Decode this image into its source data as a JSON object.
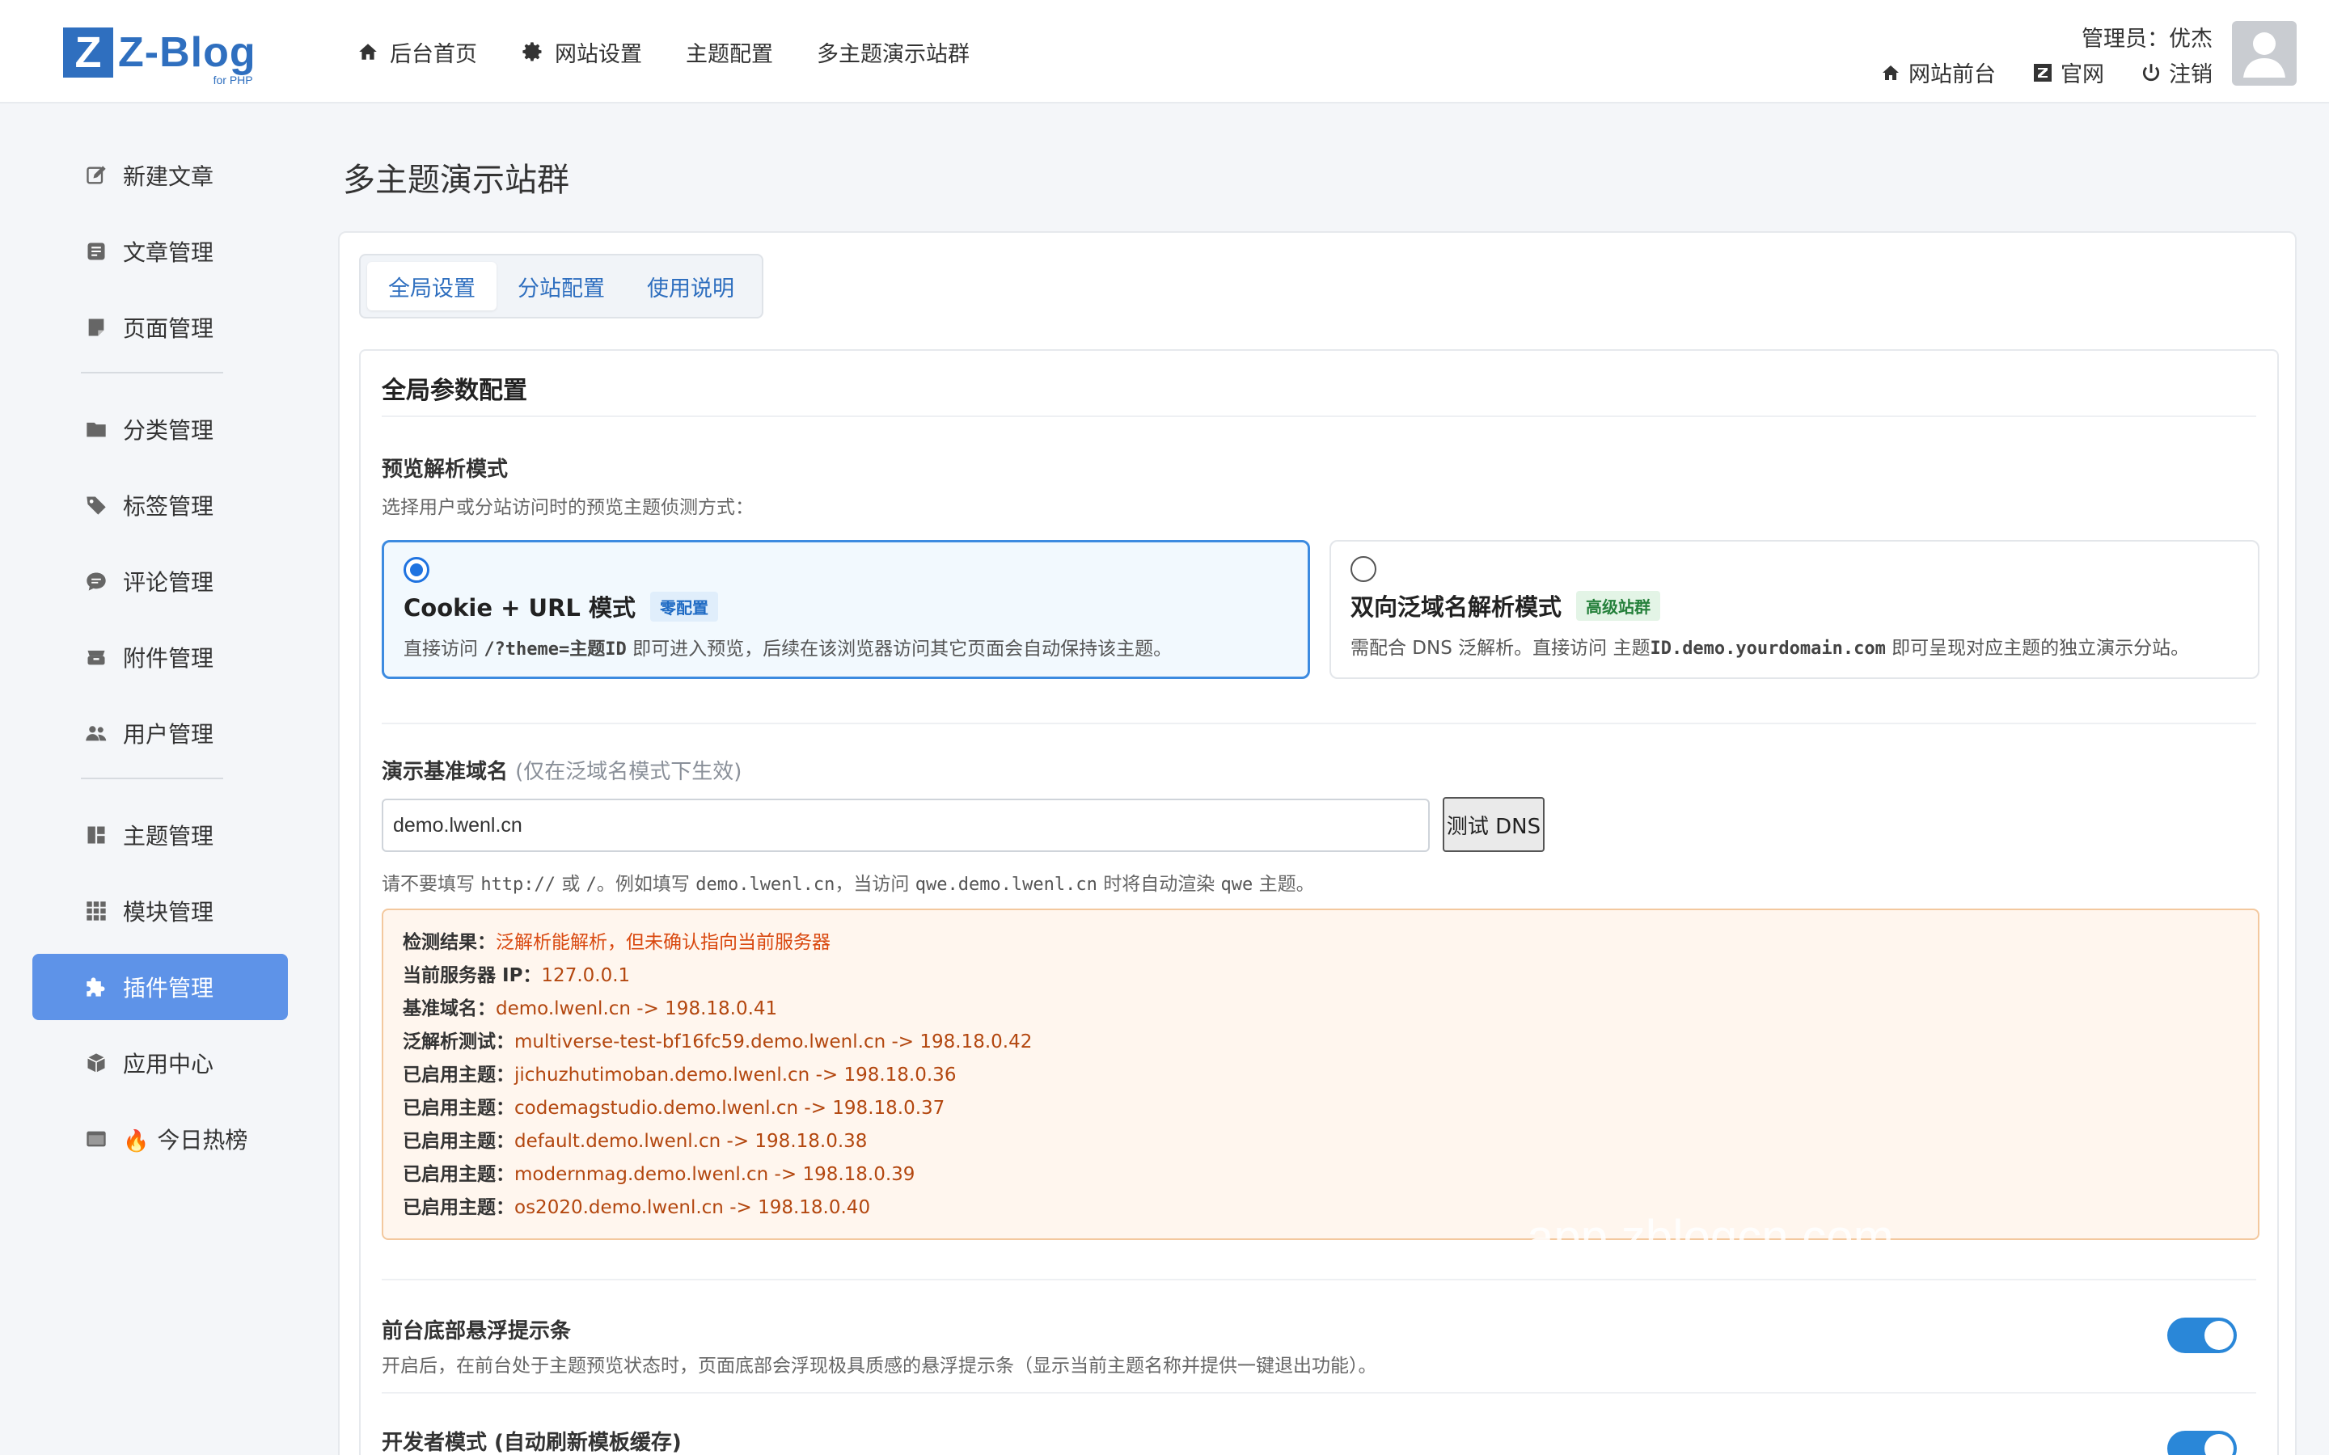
{
  "header": {
    "logo_letter": "Z",
    "logo_name": "Z-Blog",
    "logo_sub": "for PHP",
    "nav": [
      {
        "label": "后台首页",
        "icon": "home-icon"
      },
      {
        "label": "网站设置",
        "icon": "gear-icon"
      },
      {
        "label": "主题配置",
        "icon": ""
      },
      {
        "label": "多主题演示站群",
        "icon": ""
      }
    ],
    "admin_label": "管理员：优杰",
    "quick_links": [
      {
        "label": "网站前台",
        "icon": "home-icon"
      },
      {
        "label": "官网",
        "icon": "zblog-logo-icon"
      },
      {
        "label": "注销",
        "icon": "power-icon"
      }
    ]
  },
  "sidebar": {
    "items": [
      {
        "label": "新建文章",
        "icon": "edit-icon"
      },
      {
        "label": "文章管理",
        "icon": "article-icon"
      },
      {
        "label": "页面管理",
        "icon": "page-icon"
      },
      {
        "label": "分类管理",
        "icon": "folder-icon"
      },
      {
        "label": "标签管理",
        "icon": "tag-icon"
      },
      {
        "label": "评论管理",
        "icon": "comment-icon"
      },
      {
        "label": "附件管理",
        "icon": "attachment-icon"
      },
      {
        "label": "用户管理",
        "icon": "users-icon"
      },
      {
        "label": "主题管理",
        "icon": "theme-icon"
      },
      {
        "label": "模块管理",
        "icon": "grid-icon"
      },
      {
        "label": "插件管理",
        "icon": "puzzle-icon",
        "active": true
      },
      {
        "label": "应用中心",
        "icon": "box-icon"
      },
      {
        "label": "今日热榜",
        "icon": "window-icon",
        "emoji": "🔥"
      }
    ]
  },
  "main": {
    "page_title": "多主题演示站群",
    "tabs": [
      "全局设置",
      "分站配置",
      "使用说明"
    ],
    "card_title": "全局参数配置",
    "preview_mode": {
      "label": "预览解析模式",
      "desc": "选择用户或分站访问时的预览主题侦测方式：",
      "options": [
        {
          "title": "Cookie + URL 模式",
          "badge": "零配置",
          "desc_pre": "直接访问 ",
          "desc_code": "/?theme=主题ID",
          "desc_post": " 即可进入预览，后续在该浏览器访问其它页面会自动保持该主题。",
          "selected": true
        },
        {
          "title": "双向泛域名解析模式",
          "badge": "高级站群",
          "desc_pre": "需配合 DNS 泛解析。直接访问 主题",
          "desc_code": "ID.demo.yourdomain.com",
          "desc_post": " 即可呈现对应主题的独立演示分站。",
          "selected": false
        }
      ]
    },
    "base_domain": {
      "label": "演示基准域名",
      "label_note": "(仅在泛域名模式下生效)",
      "value": "demo.lwenl.cn",
      "button": "测试 DNS",
      "hint_1": "请不要填写 ",
      "hint_code_1": "http://",
      "hint_2": " 或 ",
      "hint_code_2": "/",
      "hint_3": "。例如填写 ",
      "hint_code_3": "demo.lwenl.cn",
      "hint_4": "，当访问 ",
      "hint_code_4": "qwe.demo.lwenl.cn",
      "hint_5": " 时将自动渲染 ",
      "hint_code_5": "qwe",
      "hint_6": " 主题。"
    },
    "dns_result": [
      {
        "k": "检测结果：",
        "v": "泛解析能解析，但未确认指向当前服务器",
        "err": true
      },
      {
        "k": "当前服务器 IP：",
        "v": "127.0.0.1"
      },
      {
        "k": "基准域名：",
        "v": "demo.lwenl.cn -> 198.18.0.41"
      },
      {
        "k": "泛解析测试：",
        "v": "multiverse-test-bf16fc59.demo.lwenl.cn -> 198.18.0.42"
      },
      {
        "k": "已启用主题：",
        "v": "jichuzhutimoban.demo.lwenl.cn -> 198.18.0.36"
      },
      {
        "k": "已启用主题：",
        "v": "codemagstudio.demo.lwenl.cn -> 198.18.0.37"
      },
      {
        "k": "已启用主题：",
        "v": "default.demo.lwenl.cn -> 198.18.0.38"
      },
      {
        "k": "已启用主题：",
        "v": "modernmag.demo.lwenl.cn -> 198.18.0.39"
      },
      {
        "k": "已启用主题：",
        "v": "os2020.demo.lwenl.cn -> 198.18.0.40"
      }
    ],
    "floating_bar": {
      "label": "前台底部悬浮提示条",
      "desc": "开启后，在前台处于主题预览状态时，页面底部会浮现极具质感的悬浮提示条（显示当前主题名称并提供一键退出功能）。",
      "enabled": true
    },
    "dev_mode": {
      "label": "开发者模式 (自动刷新模板缓存)",
      "enabled": true
    }
  },
  "watermark": "app.zblogcn.com",
  "colors": {
    "brand": "#2f6fbf",
    "active_sidebar": "#5e93e8",
    "toggle_on": "#2a87d8",
    "result_bg": "#fff6ee"
  }
}
